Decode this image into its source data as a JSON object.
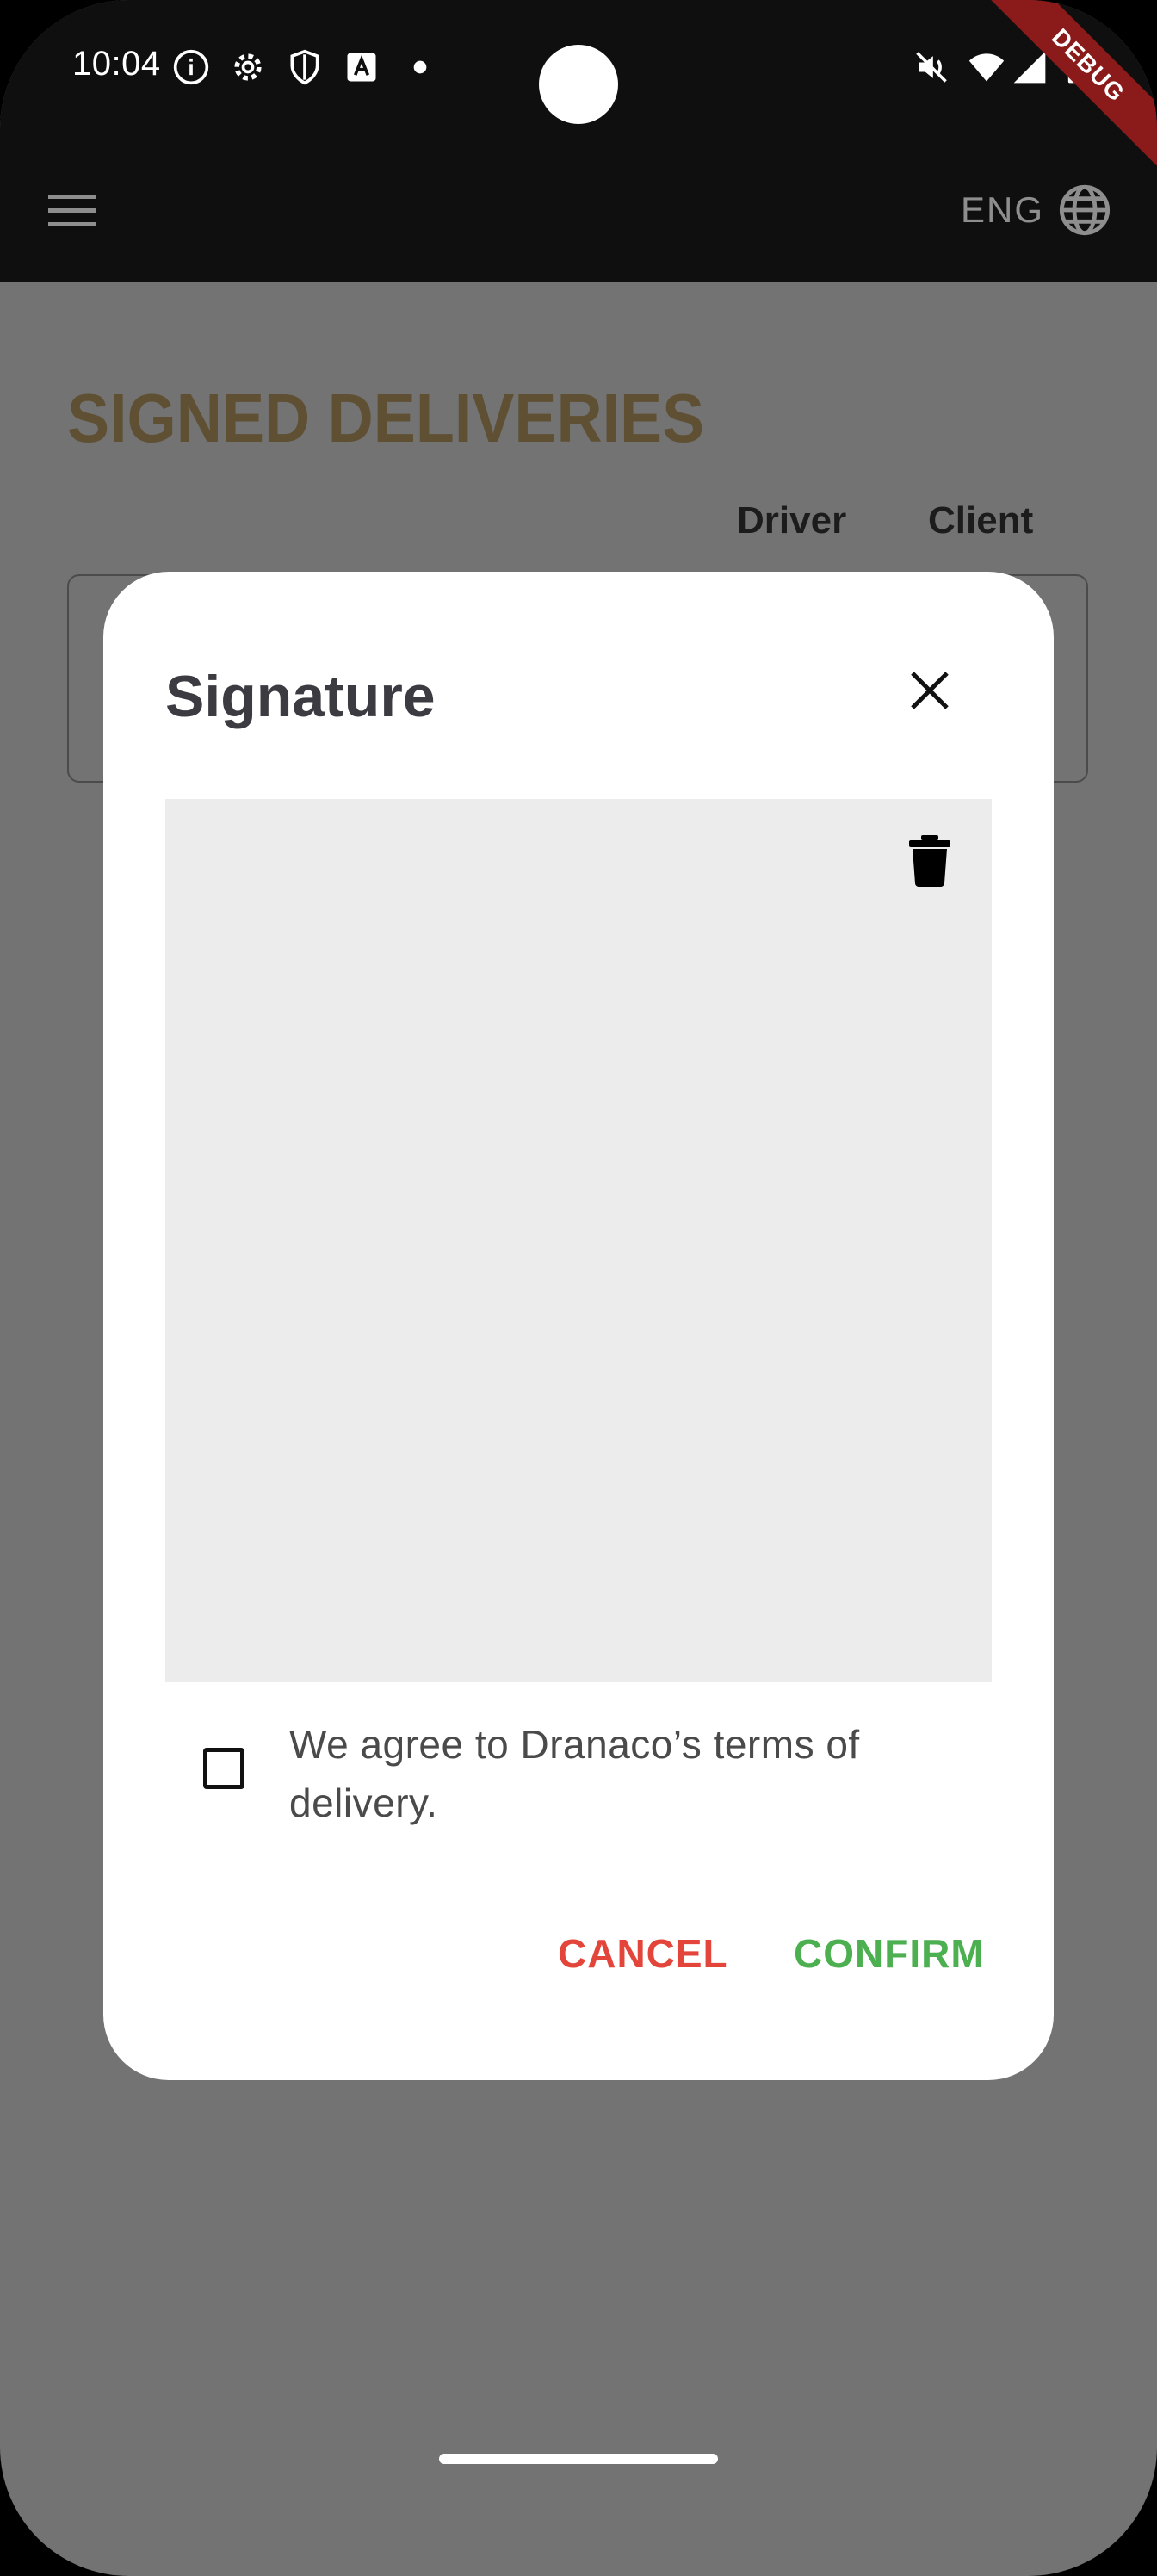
{
  "status_bar": {
    "time": "10:04",
    "icons": [
      "info-icon",
      "gear-icon",
      "shield-icon",
      "a-icon",
      "dot-icon",
      "mute-icon",
      "wifi-icon",
      "signal-icon",
      "battery-icon"
    ],
    "debug_label": "DEBUG"
  },
  "app_bar": {
    "menu_icon": "menu-icon",
    "language": "ENG",
    "language_icon": "globe-icon"
  },
  "page": {
    "title": "SIGNED DELIVERIES",
    "columns": [
      "Driver",
      "Client"
    ]
  },
  "dialog": {
    "title": "Signature",
    "terms_text": "We agree to Dranaco’s terms of delivery.",
    "terms_checked": false,
    "cancel_label": "CANCEL",
    "confirm_label": "CONFIRM"
  },
  "colors": {
    "title_gold": "#5f5033",
    "cancel_red": "#e4453a",
    "confirm_green": "#4caf50",
    "scrim": "#737373"
  }
}
